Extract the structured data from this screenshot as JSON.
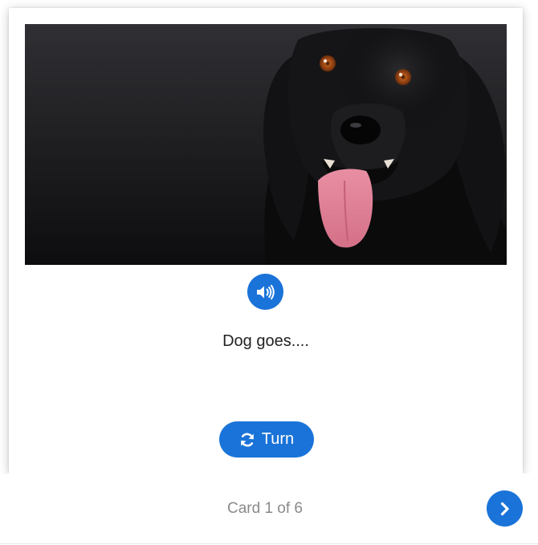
{
  "card": {
    "image_alt": "Black dog with tongue out on dark background",
    "audio_icon": "volume-up-icon",
    "prompt": "Dog goes....",
    "turn_label": "Turn",
    "turn_icon": "refresh-icon"
  },
  "footer": {
    "counter": "Card 1 of 6",
    "next_icon": "chevron-right-icon"
  },
  "colors": {
    "accent": "#1a73d8",
    "counter_text": "#8a8a8a",
    "prompt_text": "#222222"
  }
}
